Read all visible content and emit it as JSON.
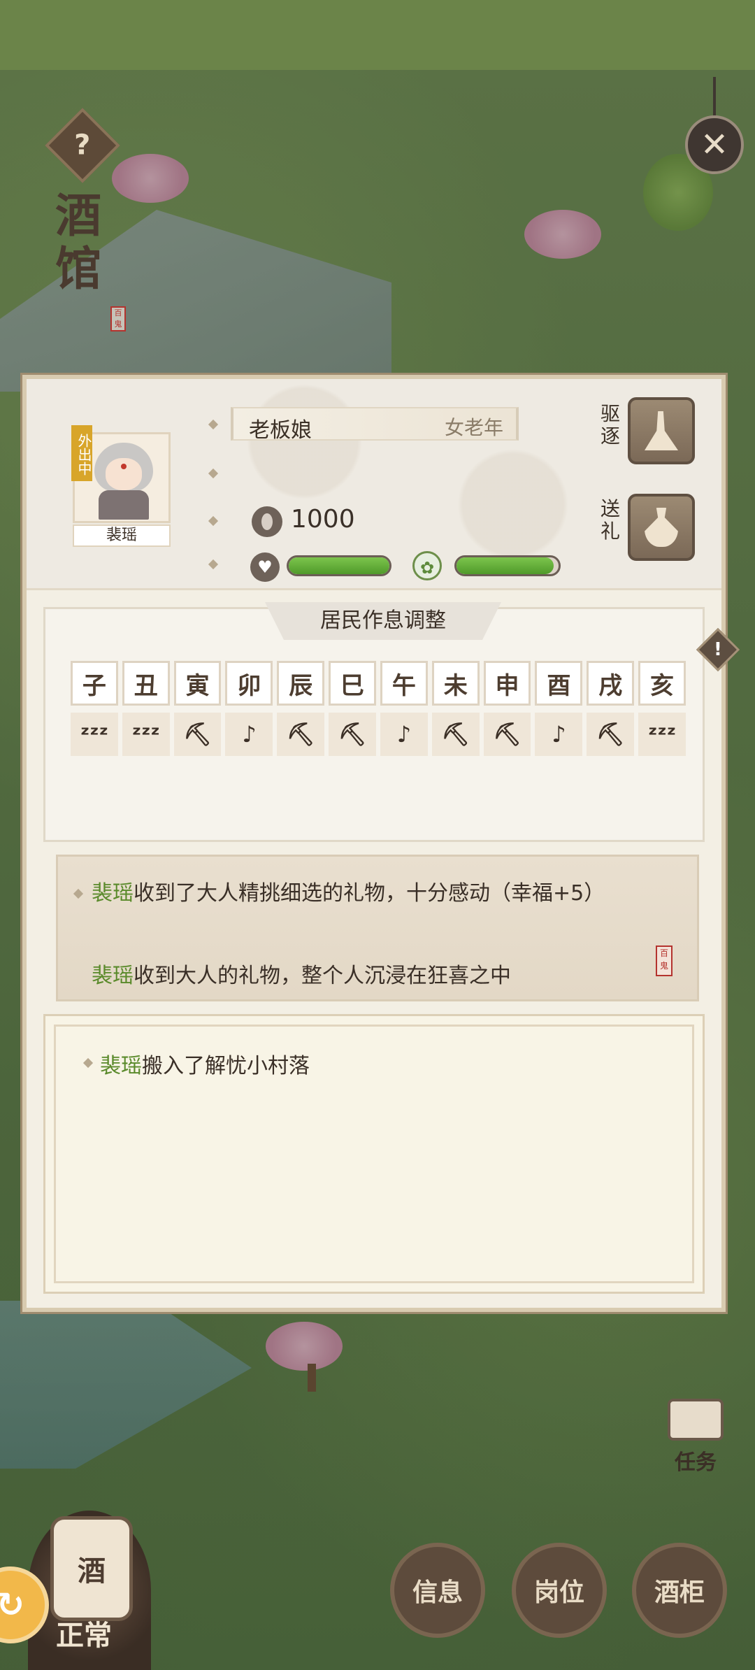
{
  "scene": {
    "title": "酒馆",
    "seal_text": "百鬼"
  },
  "character": {
    "name": "裴瑶",
    "status_badge": "外出中",
    "role": "老板娘",
    "age_gender": "女老年",
    "coin_value": "1000",
    "happiness_fill": 1.0,
    "satiety_fill": 0.95
  },
  "actions": {
    "expel_label": "驱逐",
    "gift_label": "送礼"
  },
  "schedule": {
    "title": "居民作息调整",
    "hours": [
      "子",
      "丑",
      "寅",
      "卯",
      "辰",
      "巳",
      "午",
      "未",
      "申",
      "酉",
      "戌",
      "亥"
    ],
    "activities": [
      "sleep-icon",
      "sleep-icon",
      "pickaxe-icon",
      "music-person-icon",
      "pickaxe-icon",
      "pickaxe-icon",
      "music-person-icon",
      "pickaxe-icon",
      "pickaxe-icon",
      "music-person-icon",
      "pickaxe-icon",
      "sleep-icon"
    ]
  },
  "log": {
    "line1_name": "裴瑶",
    "line1_text": "收到了大人精挑细选的礼物，十分感动（幸福+5）",
    "line2_name": "裴瑶",
    "line2_text": "收到大人的礼物，整个人沉浸在狂喜之中"
  },
  "history": {
    "line1_name": "裴瑶",
    "line1_text": "搬入了解忧小村落"
  },
  "bottom": {
    "info_label": "信息",
    "post_label": "岗位",
    "cabinet_label": "酒柜",
    "task_label": "任务",
    "tavern_label": "酒",
    "status_label": "正常"
  }
}
